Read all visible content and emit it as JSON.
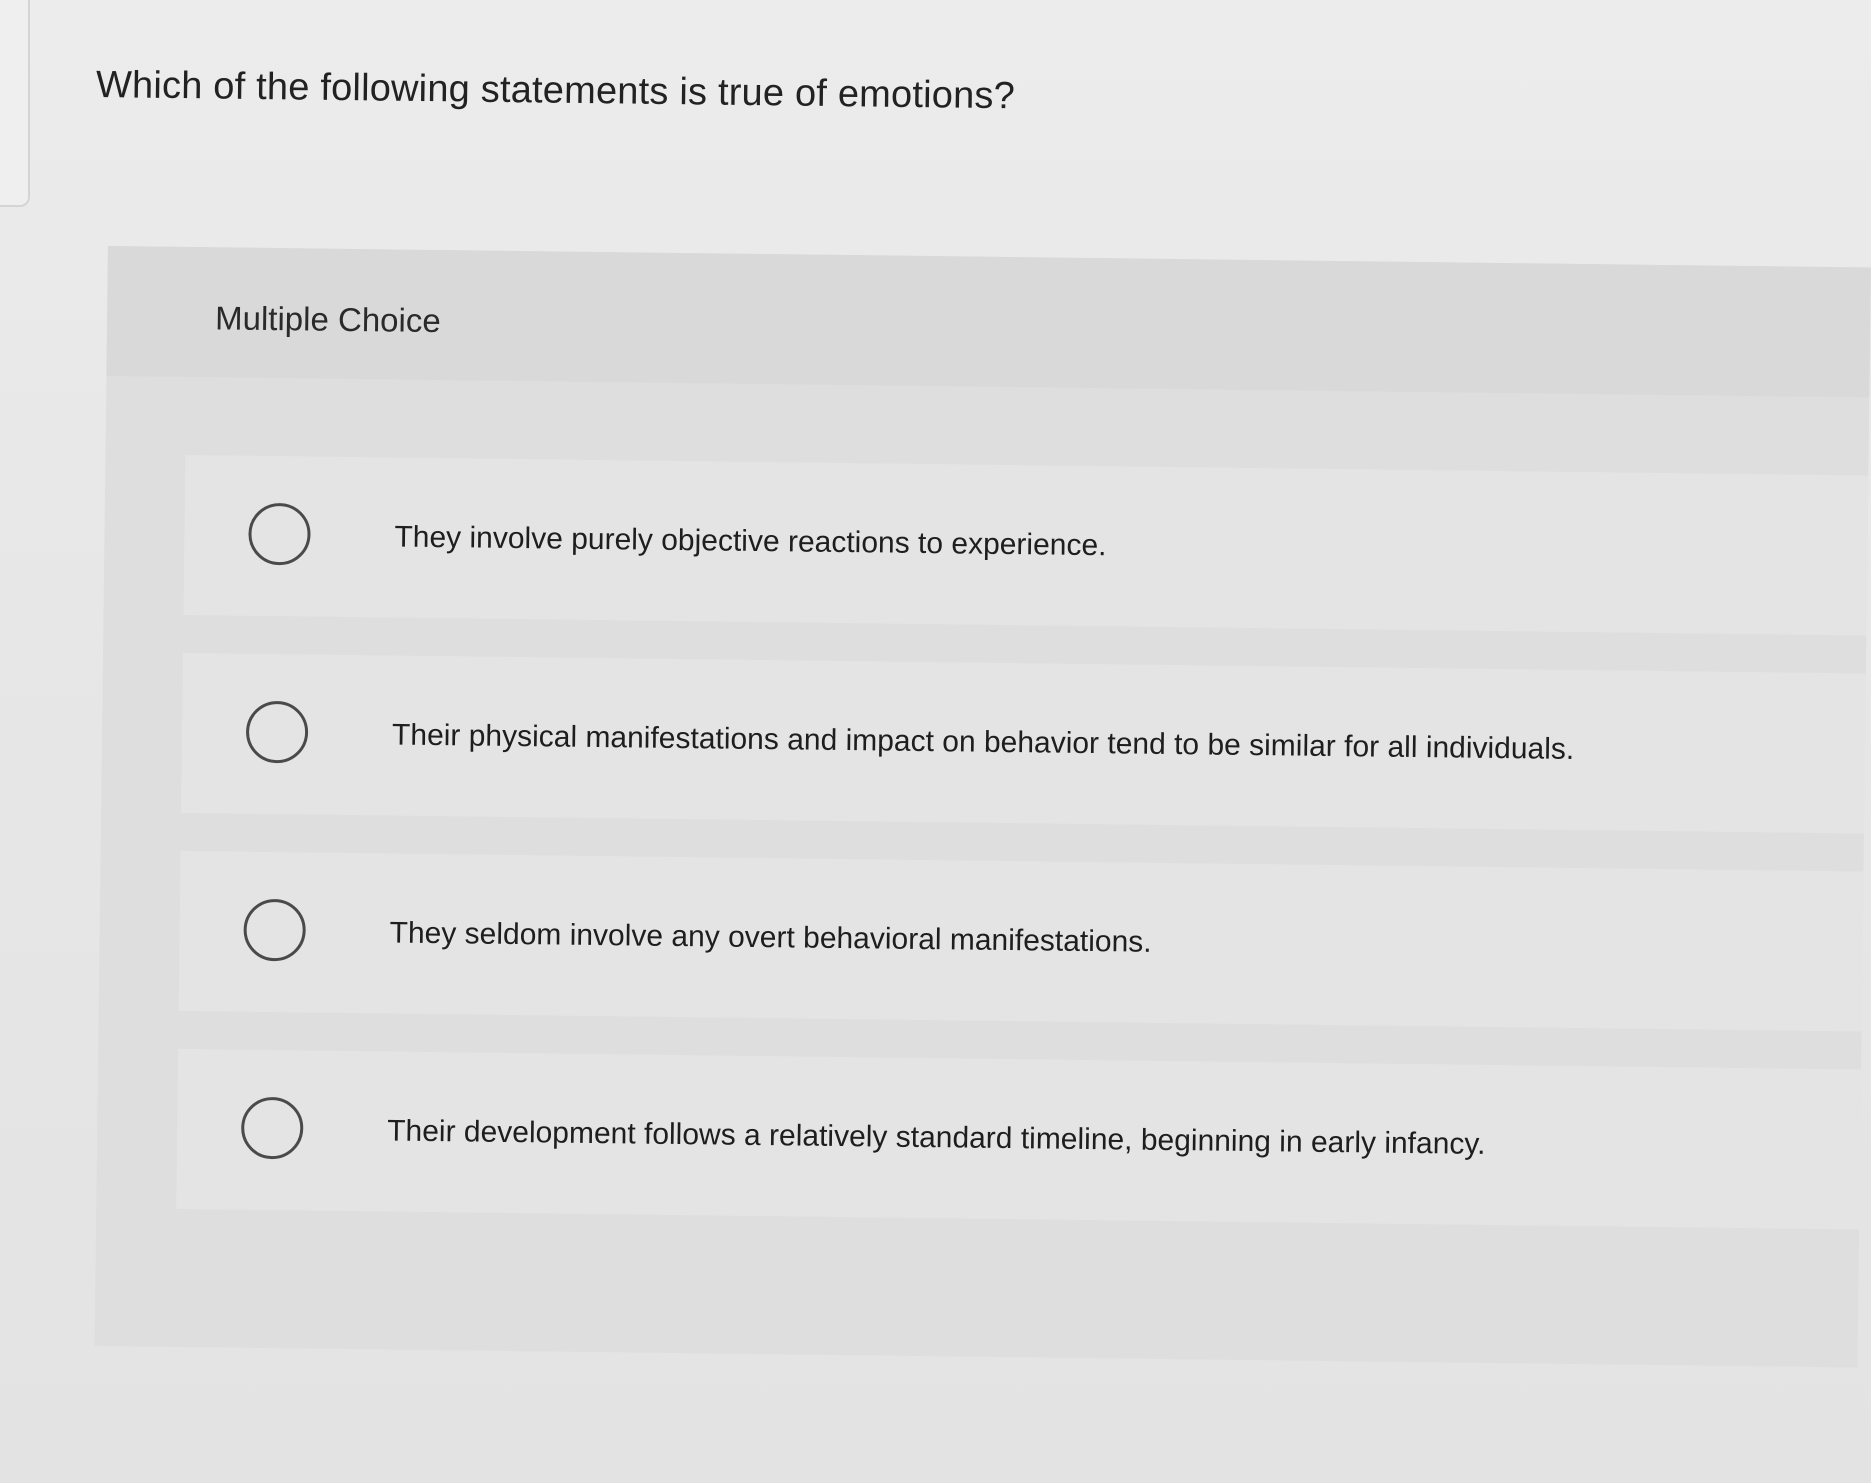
{
  "question": {
    "prompt": "Which of the following statements is true of emotions?"
  },
  "mc": {
    "label": "Multiple Choice",
    "options": [
      {
        "text": "They involve purely objective reactions to experience."
      },
      {
        "text": "Their physical manifestations and impact on behavior tend to be similar for all individuals."
      },
      {
        "text": "They seldom involve any overt behavioral manifestations."
      },
      {
        "text": "Their development follows a relatively standard timeline, beginning in early infancy."
      }
    ]
  }
}
